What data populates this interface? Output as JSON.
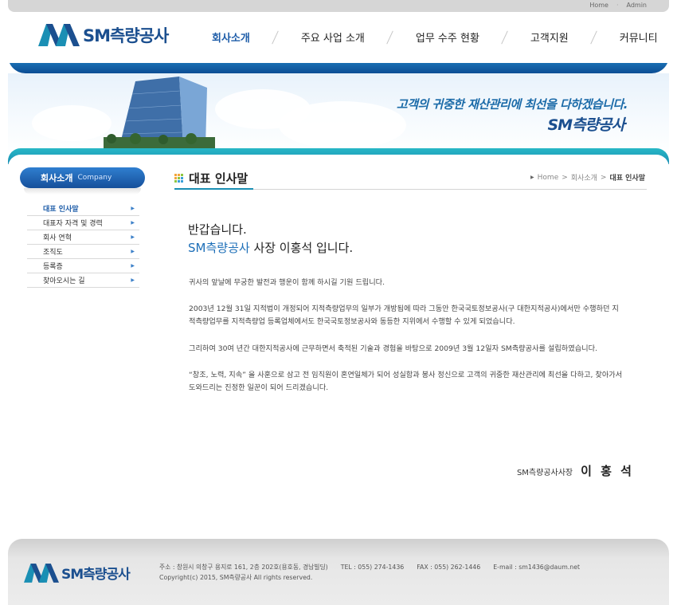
{
  "top_links": {
    "home": "Home",
    "admin": "Admin"
  },
  "brand": {
    "name": "SM측량공사",
    "accent": "#1b4f8f",
    "teal": "#1a8fb4"
  },
  "nav": [
    {
      "label": "회사소개",
      "active": true
    },
    {
      "label": "주요 사업 소개",
      "active": false
    },
    {
      "label": "업무 수주 현황",
      "active": false
    },
    {
      "label": "고객지원",
      "active": false
    },
    {
      "label": "커뮤니티",
      "active": false
    }
  ],
  "hero": {
    "line1": "고객의 귀중한 재산관리에 최선을 다하겠습니다.",
    "line2": "SM측량공사"
  },
  "sidebar": {
    "title_ko": "회사소개",
    "title_en": "Company",
    "items": [
      {
        "label": "대표 인사말",
        "active": true
      },
      {
        "label": "대표자 자격 및 경력",
        "active": false
      },
      {
        "label": "회사 연혁",
        "active": false
      },
      {
        "label": "조직도",
        "active": false
      },
      {
        "label": "등록증",
        "active": false
      },
      {
        "label": "찾아오시는 길",
        "active": false
      }
    ]
  },
  "content": {
    "title": "대표 인사말",
    "breadcrumb": {
      "home": "Home",
      "sep1": ">",
      "section": "회사소개",
      "sep2": ">",
      "current": "대표 인사말"
    },
    "greeting_line1": "반갑습니다.",
    "greeting_company": "SM측량공사",
    "greeting_rest": " 사장 이홍석 입니다.",
    "paragraphs": [
      "귀사의 앞날에 무궁한 발전과 행운이 함께 하시길 기원 드립니다.",
      "2003년 12월 31일 지적법이 개정되어 지적측량업무의 일부가 개방됨에 따라 그동안 한국국토정보공사(구 대한지적공사)에서만 수행하던 지적측량업무를 지적측량업 등록업체에서도 한국국토정보공사와 동등한 지위에서 수행할 수 있게 되었습니다.",
      "그리하여 30여 년간 대한지적공사에 근무하면서 축적된 기술과 경험을 바탕으로 2009년 3월 12일자 SM측량공사를 설립하였습니다.",
      "“창조, 노력, 지속” 을 사훈으로 삼고 전 임직원이 혼연일체가 되어 성실함과 봉사 정신으로 고객의 귀중한 재산관리에 최선을 다하고, 찾아가서 도와드리는 진정한 일꾼이 되어 드리겠습니다."
    ],
    "sign_org": "SM측량공사사장",
    "sign_name": "이 홍 석"
  },
  "footer": {
    "address": "주소 : 창원시 의창구 용지로 161, 2층 202호(용호동, 경남빌딩)",
    "tel": "TEL : 055) 274-1436",
    "fax": "FAX : 055) 262-1446",
    "email": "E-mail : sm1436@daum.net",
    "copyright": "Copyright(c) 2015, SM측량공사 All rights reserved."
  }
}
